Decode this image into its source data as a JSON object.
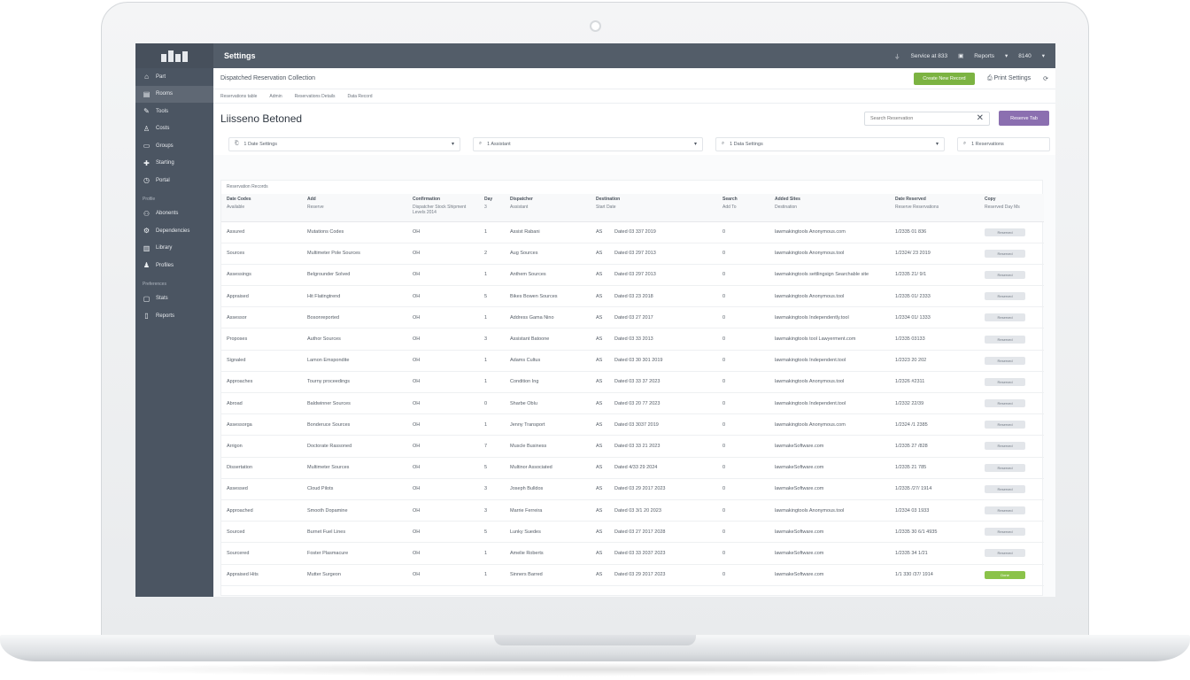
{
  "app": {
    "title": "Settings"
  },
  "topbar": {
    "status": "Service at 833",
    "user": "Reports",
    "menu": "8140"
  },
  "sidebar": {
    "items": [
      {
        "label": "Part",
        "icon": "home-icon"
      },
      {
        "label": "Rooms",
        "icon": "grid-icon",
        "active": true
      },
      {
        "label": "Tools",
        "icon": "tools-icon"
      },
      {
        "label": "Costs",
        "icon": "user-icon"
      },
      {
        "label": "Groups",
        "icon": "group-icon"
      },
      {
        "label": "Starting",
        "icon": "pin-icon"
      },
      {
        "label": "Portal",
        "icon": "clock-icon"
      }
    ],
    "section1": "Profile",
    "section1_items": [
      {
        "label": "Abonents",
        "icon": "team-icon"
      },
      {
        "label": "Dependencies",
        "icon": "gear-icon"
      },
      {
        "label": "Library",
        "icon": "book-icon"
      },
      {
        "label": "Profiles",
        "icon": "person-icon"
      }
    ],
    "section2": "Preferences",
    "section2_items": [
      {
        "label": "Stats",
        "icon": "chat-icon"
      },
      {
        "label": "Reports",
        "icon": "doc-icon"
      }
    ]
  },
  "breadcrumb": {
    "text": "Dispatched Reservation Collection"
  },
  "actions": {
    "green_button": "Create New Record",
    "link": "Print Settings"
  },
  "subnav": {
    "items": [
      "Reservations table",
      "Admin",
      "Reservations Details",
      "Data Record"
    ]
  },
  "page": {
    "title": "Liisseno Betoned"
  },
  "search": {
    "placeholder": "Search Reservation"
  },
  "buttons": {
    "purple": "Reserve Tab"
  },
  "filters": [
    {
      "value": "1  Date Settings"
    },
    {
      "value": "1  Assistant"
    },
    {
      "value": "1  Data Settings"
    },
    {
      "value": "1  Reservations"
    }
  ],
  "table": {
    "section_label": "Reservation Records",
    "headers": [
      {
        "label": "Date Codes",
        "sub": "Available"
      },
      {
        "label": "Add",
        "sub": "Reserve"
      },
      {
        "label": "Confirmation",
        "sub": "Dispatcher Stock Shipment Levels 2014"
      },
      {
        "label": "Day",
        "sub": "3"
      },
      {
        "label": "Dispatcher",
        "sub": "Assistant"
      },
      {
        "label": "Destination",
        "sub": "Start Date"
      },
      {
        "label": "Search",
        "sub": "Add To"
      },
      {
        "label": "Added Sites",
        "sub": "Destination"
      },
      {
        "label": "Date Reserved",
        "sub": "Reserve Reservations"
      },
      {
        "label": "Copy",
        "sub": "Reserved Day Ms"
      }
    ],
    "rows": [
      [
        "Assured",
        "Mutations Codes",
        "OH",
        "1",
        "Assist Rabani",
        "AS",
        "Dated 03 337 2019",
        "0",
        "lawmakingtools Anonymous.com",
        "1/2335 01 836",
        "Reserved"
      ],
      [
        "Sources",
        "Multimeter Pole Sources",
        "OH",
        "2",
        "Aug Sources",
        "AS",
        "Dated 03 297 2013",
        "0",
        "lawmakingtools Anonymous.tool",
        "1/2324/ 23 2019",
        "Reserved"
      ],
      [
        "Assessings",
        "Belgrounder Solved",
        "OH",
        "1",
        "Anthem Sources",
        "AS",
        "Dated 03 297 2013",
        "0",
        "lawmakingtools settlingsign Searchable site",
        "1/2335 21/ 9/1",
        "Reserved"
      ],
      [
        "Appraised",
        "Hit Flatingtrend",
        "OH",
        "5",
        "Bikes Bowen Sources",
        "AS",
        "Dated 03 23 2018",
        "0",
        "lawmakingtools Anonymous.tool",
        "1/2335 01/ 2333",
        "Reserved"
      ],
      [
        "Assessor",
        "Bosonreported",
        "OH",
        "1",
        "Address Gama Nino",
        "AS",
        "Dated 03 27 2017",
        "0",
        "lawmakingtools Independently.tool",
        "1/2334 01/ 1333",
        "Reserved"
      ],
      [
        "Proposes",
        "Author Sources",
        "OH",
        "3",
        "Assistant Batoone",
        "AS",
        "Dated 03 33 2013",
        "0",
        "lawmakingtools tool Lawyerment.com",
        "1/2335 03133",
        "Reserved"
      ],
      [
        "Signaled",
        "Lamon Emspondite",
        "OH",
        "1",
        "Adams Cultus",
        "AS",
        "Dated 03 30 301 2019",
        "0",
        "lawmakingtools Independent.tool",
        "1/2323 20 202",
        "Reserved"
      ],
      [
        "Approaches",
        "Tourny proceedings",
        "OH",
        "1",
        "Condition Ing",
        "AS",
        "Dated 03 33 37 2023",
        "0",
        "lawmakingtools Anonymous.tool",
        "1/2326 #2311",
        "Reserved"
      ],
      [
        "Abroad",
        "Baldwinner Sources",
        "OH",
        "0",
        "Sharbe Oblu",
        "AS",
        "Dated 03 20 77 2023",
        "0",
        "lawmakingtools Independent.tool",
        "1/2332 22/39",
        "Reserved"
      ],
      [
        "Assessorga",
        "Bonderuce Sources",
        "OH",
        "1",
        "Jenny Transport",
        "AS",
        "Dated 03 3037 2019",
        "0",
        "lawmakingtools Anonymous.com",
        "1/2324 /1 2385",
        "Reserved"
      ],
      [
        "Arrigon",
        "Doctorate Rassoned",
        "OH",
        "7",
        "Muscle Business",
        "AS",
        "Dated 03 33 21 2023",
        "0",
        "lawmakeSoftware.com",
        "1/2335 27 /828",
        "Reserved"
      ],
      [
        "Dissertation",
        "Multimeter Sources",
        "OH",
        "5",
        "Multinor Associated",
        "AS",
        "Dated 4/33 29 2024",
        "0",
        "lawmakeSoftware.com",
        "1/2335 21 785",
        "Reserved"
      ],
      [
        "Assessed",
        "Cloud Pilots",
        "OH",
        "3",
        "Joseph Bulldos",
        "AS",
        "Dated 03 29 2017 2023",
        "0",
        "lawmakeSoftware.com",
        "1/2335 /27/ 1914",
        "Reserved"
      ],
      [
        "Approached",
        "Smooth Dopamine",
        "OH",
        "3",
        "Marrie Ferreira",
        "AS",
        "Dated 03 3/1 20 2023",
        "0",
        "lawmakingtools Anonymous.tool",
        "1/2334 03 1933",
        "Reserved"
      ],
      [
        "Sourced",
        "Burnet Fuel Lines",
        "OH",
        "5",
        "Lunky Suedes",
        "AS",
        "Dated 03 27 2017 2028",
        "0",
        "lawmakeSoftware.com",
        "1/2335 30 6/1 4935",
        "Reserved"
      ],
      [
        "Sourcered",
        "Foster Plasmacure",
        "OH",
        "1",
        "Amelie Roberts",
        "AS",
        "Dated 03 33 2037 2023",
        "0",
        "lawmakeSoftware.com",
        "1/2335 34 1/21",
        "Reserved"
      ],
      [
        "Appraised Hits",
        "Mutter Surgeon",
        "OH",
        "1",
        "Sinners Barred",
        "AS",
        "Dated 03 29 2017 2023",
        "0",
        "lawmakeSoftware.com",
        "1/1 330 /37/ 1914",
        "Done"
      ]
    ]
  }
}
